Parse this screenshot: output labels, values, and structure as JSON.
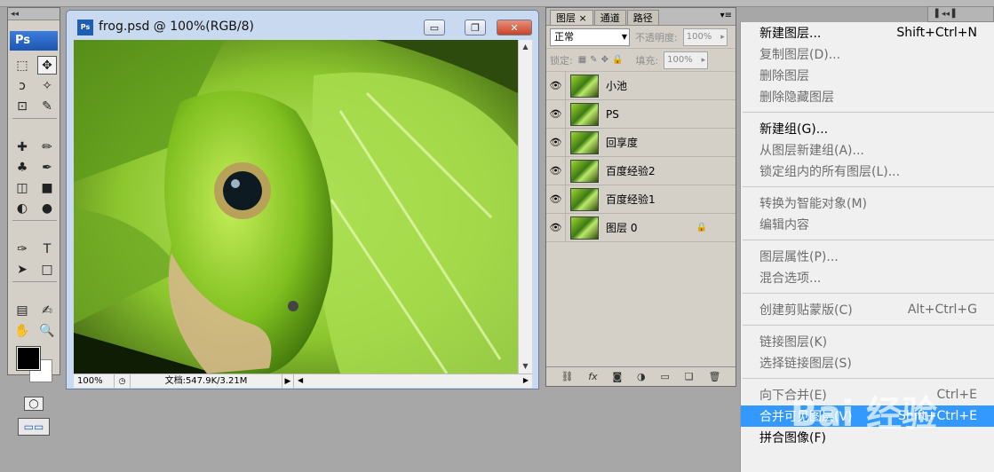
{
  "tools": {
    "logo": "Ps",
    "icons": [
      "marquee-icon",
      "move-icon",
      "lasso-icon",
      "magic-wand-icon",
      "crop-icon",
      "eyedropper-icon",
      "healing-icon",
      "brush-icon",
      "stamp-icon",
      "history-brush-icon",
      "eraser-icon",
      "gradient-icon",
      "blur-icon",
      "dodge-icon",
      "pen-icon",
      "type-icon",
      "path-select-icon",
      "shape-icon",
      "notes-icon",
      "eyedropper2-icon",
      "hand-icon",
      "zoom-icon"
    ],
    "glyphs": [
      "⬚",
      "✥",
      "ↄ",
      "✧",
      "⊡",
      "✎",
      "✚",
      "✏",
      "♣",
      "✒",
      "◫",
      "■",
      "◐",
      "●",
      "✑",
      "T",
      "➤",
      "□",
      "▤",
      "✍",
      "✋",
      "🔍"
    ]
  },
  "document": {
    "title": "frog.psd @ 100%(RGB/8)",
    "badge": "Ps",
    "minimize": "▭",
    "restore": "❐",
    "close": "✕",
    "zoom": "100%",
    "info": "文档:547.9K/3.21M"
  },
  "layers_panel": {
    "tabs": [
      "图层",
      "通道",
      "路径"
    ],
    "tab_close": "×",
    "blend_mode": "正常",
    "opacity_label": "不透明度:",
    "opacity_value": "100%",
    "lock_label": "锁定:",
    "fill_label": "填充:",
    "fill_value": "100%",
    "layers": [
      {
        "name": "小池",
        "locked": false
      },
      {
        "name": "PS",
        "locked": false
      },
      {
        "name": "回享度",
        "locked": false
      },
      {
        "name": "百度经验2",
        "locked": false
      },
      {
        "name": "百度经验1",
        "locked": false
      },
      {
        "name": "图层 0",
        "locked": true
      }
    ],
    "bottom_icons": [
      "link-icon",
      "fx-icon",
      "mask-icon",
      "adjustment-icon",
      "group-icon",
      "new-layer-icon",
      "trash-icon"
    ]
  },
  "context_menu": {
    "items": [
      {
        "label": "新建图层...",
        "shortcut": "Shift+Ctrl+N",
        "disabled": false
      },
      {
        "label": "复制图层(D)...",
        "shortcut": "",
        "disabled": true
      },
      {
        "label": "删除图层",
        "shortcut": "",
        "disabled": true
      },
      {
        "label": "删除隐藏图层",
        "shortcut": "",
        "disabled": true
      },
      {
        "label": "新建组(G)...",
        "shortcut": "",
        "disabled": false
      },
      {
        "label": "从图层新建组(A)...",
        "shortcut": "",
        "disabled": true
      },
      {
        "label": "锁定组内的所有图层(L)...",
        "shortcut": "",
        "disabled": true
      },
      {
        "label": "转换为智能对象(M)",
        "shortcut": "",
        "disabled": true
      },
      {
        "label": "编辑内容",
        "shortcut": "",
        "disabled": true
      },
      {
        "label": "图层属性(P)...",
        "shortcut": "",
        "disabled": true
      },
      {
        "label": "混合选项...",
        "shortcut": "",
        "disabled": true
      },
      {
        "label": "创建剪贴蒙版(C)",
        "shortcut": "Alt+Ctrl+G",
        "disabled": true
      },
      {
        "label": "链接图层(K)",
        "shortcut": "",
        "disabled": true
      },
      {
        "label": "选择链接图层(S)",
        "shortcut": "",
        "disabled": true
      },
      {
        "label": "向下合并(E)",
        "shortcut": "Ctrl+E",
        "disabled": true
      },
      {
        "label": "合并可见图层(V)",
        "shortcut": "Shift+Ctrl+E",
        "disabled": false,
        "highlighted": true
      },
      {
        "label": "拼合图像(F)",
        "shortcut": "",
        "disabled": false
      }
    ]
  },
  "watermark": "Bai 经验"
}
